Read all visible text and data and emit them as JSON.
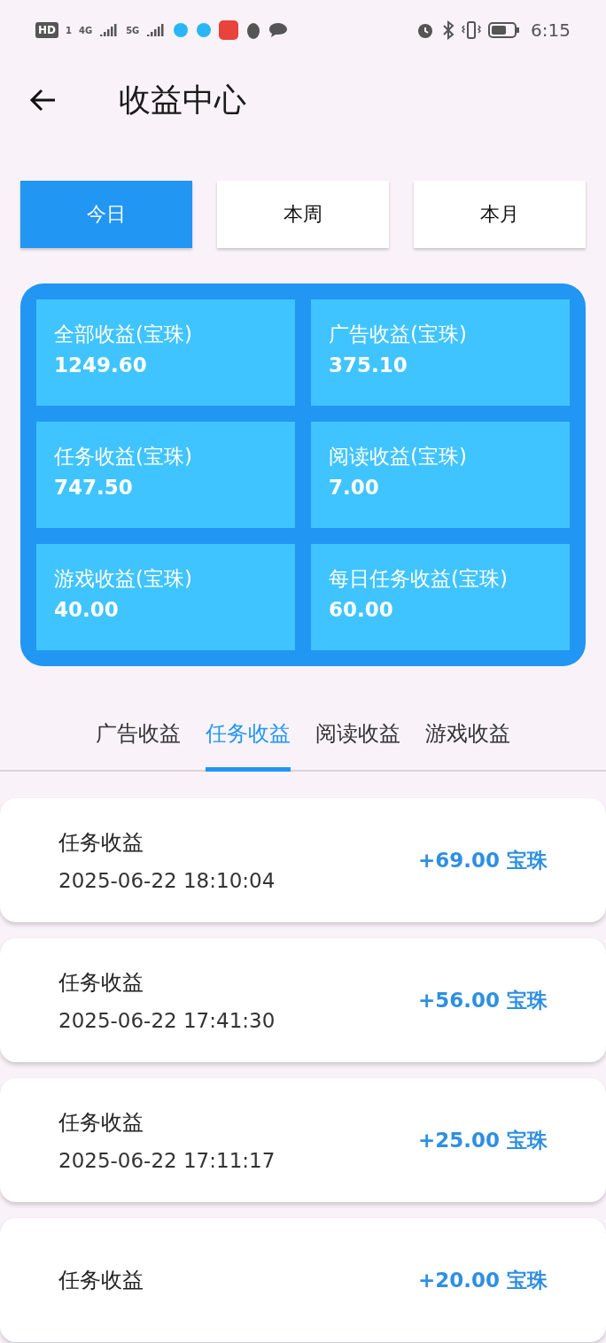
{
  "status_bar": {
    "hd": "HD",
    "hd_sim": "1",
    "networks": [
      "4G",
      "5G"
    ],
    "time": "6:15"
  },
  "header": {
    "title": "收益中心"
  },
  "periods": [
    {
      "label": "今日",
      "selected": true
    },
    {
      "label": "本周",
      "selected": false
    },
    {
      "label": "本月",
      "selected": false
    }
  ],
  "stats": [
    {
      "label": "全部收益(宝珠)",
      "value": "1249.60"
    },
    {
      "label": "广告收益(宝珠)",
      "value": "375.10"
    },
    {
      "label": "任务收益(宝珠)",
      "value": "747.50"
    },
    {
      "label": "阅读收益(宝珠)",
      "value": "7.00"
    },
    {
      "label": "游戏收益(宝珠)",
      "value": "40.00"
    },
    {
      "label": "每日任务收益(宝珠)",
      "value": "60.00"
    }
  ],
  "categories": [
    {
      "label": "广告收益",
      "selected": false
    },
    {
      "label": "任务收益",
      "selected": true
    },
    {
      "label": "阅读收益",
      "selected": false
    },
    {
      "label": "游戏收益",
      "selected": false
    }
  ],
  "records": [
    {
      "title": "任务收益",
      "time": "2025-06-22 18:10:04",
      "amount": "+69.00 宝珠"
    },
    {
      "title": "任务收益",
      "time": "2025-06-22 17:41:30",
      "amount": "+56.00 宝珠"
    },
    {
      "title": "任务收益",
      "time": "2025-06-22 17:11:17",
      "amount": "+25.00 宝珠"
    },
    {
      "title": "任务收益",
      "amount": "+20.00 宝珠"
    }
  ]
}
